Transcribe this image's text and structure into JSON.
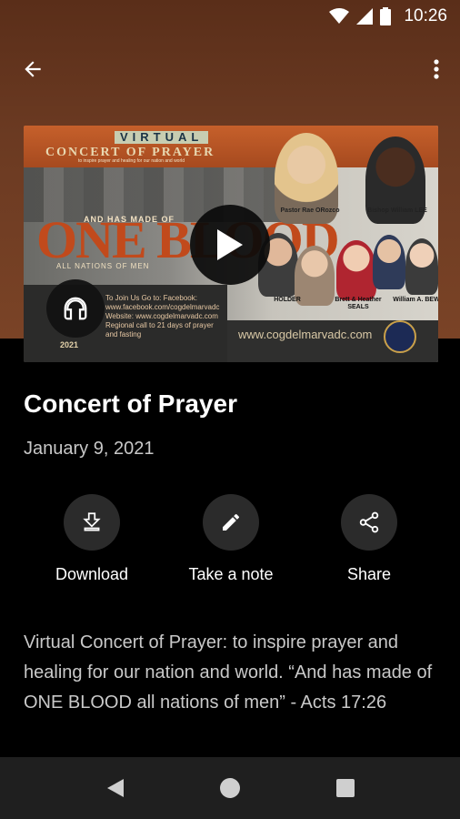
{
  "status_bar": {
    "time": "10:26"
  },
  "appbar": {
    "back_icon": "arrow-back-icon",
    "more_icon": "more-vert-icon"
  },
  "artwork": {
    "virtual": "VIRTUAL",
    "title": "CONCERT OF PRAYER",
    "subtitle": "to inspire prayer and healing for our nation and world",
    "made_of": "AND HAS MADE OF",
    "one_blood": "ONE BLOOD",
    "nations": "ALL NATIONS OF MEN",
    "join": "To Join Us Go to: Facebook: www.facebook.com/cogdelmarvadc Website: www.cogdelmarvadc.com Regional call to 21 days of prayer and fasting",
    "year": "2021",
    "label_1": "Pastor Rae ORozco",
    "label_2": "Bishop William LEE",
    "label_3": "HOLDER",
    "label_4": "Brett & Heather SEALS",
    "label_5": "William A. BEW",
    "url": "www.cogdelmarvadc.com"
  },
  "media": {
    "play_icon": "play-icon",
    "audio_icon": "headphones-icon"
  },
  "episode": {
    "title": "Concert of Prayer",
    "date": "January 9, 2021"
  },
  "actions": [
    {
      "label": "Download",
      "icon": "download-icon"
    },
    {
      "label": "Take a note",
      "icon": "pencil-icon"
    },
    {
      "label": "Share",
      "icon": "share-icon"
    }
  ],
  "description": "Virtual Concert of Prayer: to inspire prayer and healing for our nation and world. “And has made of ONE BLOOD all nations of men” - Acts 17:26",
  "colors": {
    "header_bg": "#6b3a22",
    "background": "#000000",
    "button_bg": "#2b2b2b"
  }
}
